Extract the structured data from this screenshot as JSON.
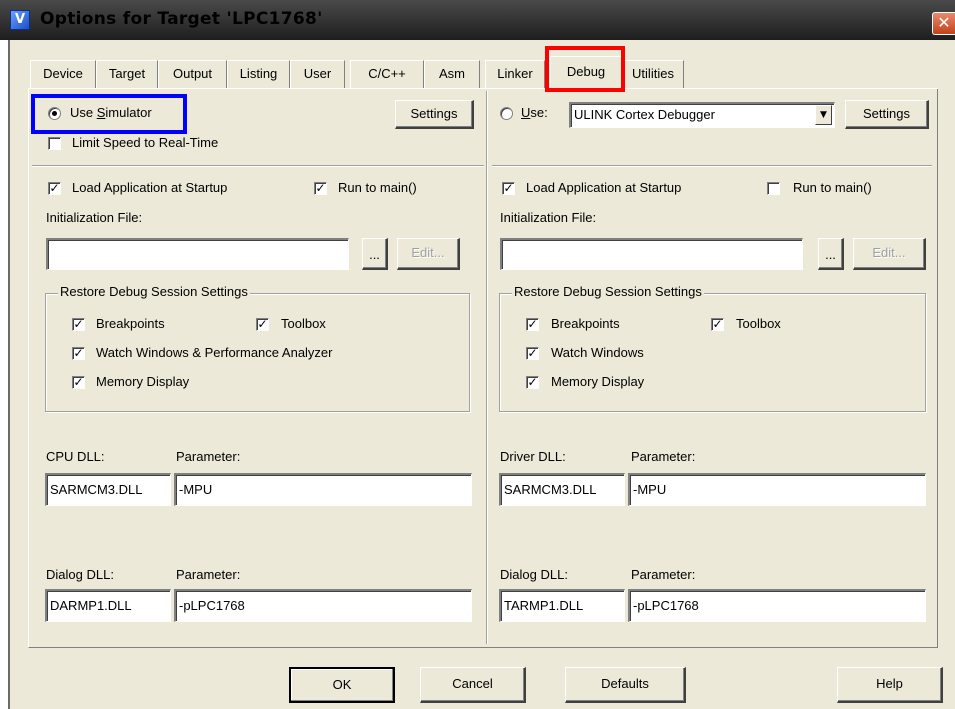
{
  "window": {
    "title": "Options for Target 'LPC1768'",
    "icon": "keil-uvision-icon",
    "close_glyph": "✕"
  },
  "tabs": [
    {
      "label": "Device",
      "active": false
    },
    {
      "label": "Target",
      "active": false
    },
    {
      "label": "Output",
      "active": false
    },
    {
      "label": "Listing",
      "active": false
    },
    {
      "label": "User",
      "active": false
    },
    {
      "label": "C/C++",
      "active": false
    },
    {
      "label": "Asm",
      "active": false
    },
    {
      "label": "Linker",
      "active": false
    },
    {
      "label": "Debug",
      "active": true
    },
    {
      "label": "Utilities",
      "active": false
    }
  ],
  "highlights": {
    "debug_tab_color": "#ff0000",
    "simulator_color": "#0000ff"
  },
  "left": {
    "use_simulator": {
      "label_prefix": "Use ",
      "label_underlined": "S",
      "label_suffix": "imulator",
      "selected": true
    },
    "settings_label": "Settings",
    "limit_speed": {
      "label": "Limit Speed to Real-Time",
      "checked": false
    },
    "load_app": {
      "label": "Load Application at Startup",
      "checked": true
    },
    "run_to_main": {
      "label": "Run to main()",
      "checked": true
    },
    "init_file_label": "Initialization File:",
    "init_file_value": "",
    "browse_label": "...",
    "edit_label": "Edit...",
    "restore_group_title": "Restore Debug Session Settings",
    "breakpoints": {
      "label": "Breakpoints",
      "checked": true
    },
    "toolbox": {
      "label": "Toolbox",
      "checked": true
    },
    "watch": {
      "label": "Watch Windows & Performance Analyzer",
      "checked": true
    },
    "memory": {
      "label": "Memory Display",
      "checked": true
    },
    "dll_label": "CPU DLL:",
    "dll_param_label": "Parameter:",
    "dll_value": "SARMCM3.DLL",
    "dll_param_value": "-MPU",
    "dialog_dll_label": "Dialog DLL:",
    "dialog_param_label": "Parameter:",
    "dialog_dll_value": "DARMP1.DLL",
    "dialog_param_value": "-pLPC1768"
  },
  "right": {
    "use": {
      "label_underlined": "U",
      "label_suffix": "se:",
      "selected": false
    },
    "debugger_value": "ULINK Cortex Debugger",
    "settings_label": "Settings",
    "load_app": {
      "label": "Load Application at Startup",
      "checked": true
    },
    "run_to_main": {
      "label": "Run to main()",
      "checked": false
    },
    "init_file_label": "Initialization File:",
    "init_file_value": "",
    "browse_label": "...",
    "edit_label": "Edit...",
    "restore_group_title": "Restore Debug Session Settings",
    "breakpoints": {
      "label": "Breakpoints",
      "checked": true
    },
    "toolbox": {
      "label": "Toolbox",
      "checked": true
    },
    "watch": {
      "label": "Watch Windows",
      "checked": true
    },
    "memory": {
      "label": "Memory Display",
      "checked": true
    },
    "dll_label": "Driver DLL:",
    "dll_param_label": "Parameter:",
    "dll_value": "SARMCM3.DLL",
    "dll_param_value": "-MPU",
    "dialog_dll_label": "Dialog DLL:",
    "dialog_param_label": "Parameter:",
    "dialog_dll_value": "TARMP1.DLL",
    "dialog_param_value": "-pLPC1768"
  },
  "footer": {
    "ok": "OK",
    "cancel": "Cancel",
    "defaults": "Defaults",
    "help": "Help"
  },
  "glyphs": {
    "check": "✓",
    "dropdown": "▼"
  }
}
